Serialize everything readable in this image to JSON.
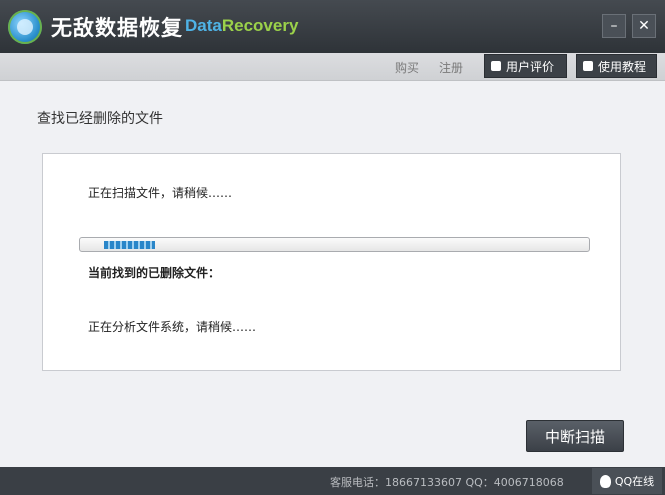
{
  "app": {
    "title": "无敌数据恢复",
    "subtitle_part1": "Data",
    "subtitle_part2": "Recovery",
    "minimize_symbol": "–",
    "close_symbol": "✕"
  },
  "toolbar": {
    "buy_label": "购买",
    "register_label": "注册",
    "review_label": "用户评价",
    "guide_label": "使用教程"
  },
  "main": {
    "heading": "查找已经删除的文件",
    "scan_status": "正在扫描文件，请稍候……",
    "progress_fraction": 0.11,
    "found_label": "当前找到的已删除文件：",
    "analyze_status": "正在分析文件系统，请稍候……",
    "stop_button": "中断扫描"
  },
  "footer": {
    "service_info": "客服电话：18667133607  QQ：4006718068",
    "qq_online": "QQ在线"
  },
  "colors": {
    "accent_blue": "#4fb3e6",
    "accent_green": "#9bd14a",
    "dark_bar": "#3a3f45"
  }
}
